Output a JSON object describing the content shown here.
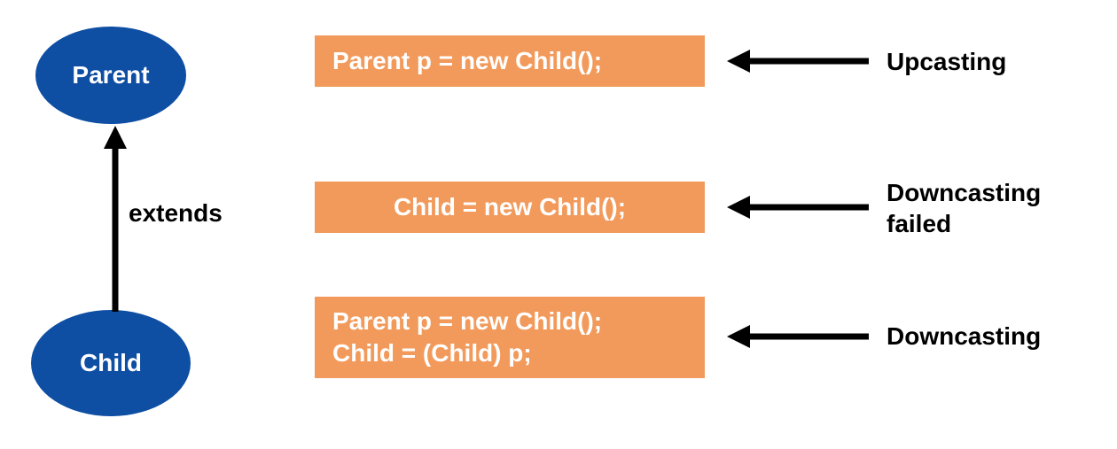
{
  "ellipses": {
    "parent": "Parent",
    "child": "Child"
  },
  "extendsLabel": "extends",
  "codeBoxes": {
    "box1": "Parent p = new Child();",
    "box2": "Child = new Child();",
    "box3_line1": "Parent p = new Child();",
    "box3_line2": "Child  = (Child) p;"
  },
  "rightLabels": {
    "label1": "Upcasting",
    "label2_line1": "Downcasting",
    "label2_line2": "failed",
    "label3": "Downcasting"
  }
}
